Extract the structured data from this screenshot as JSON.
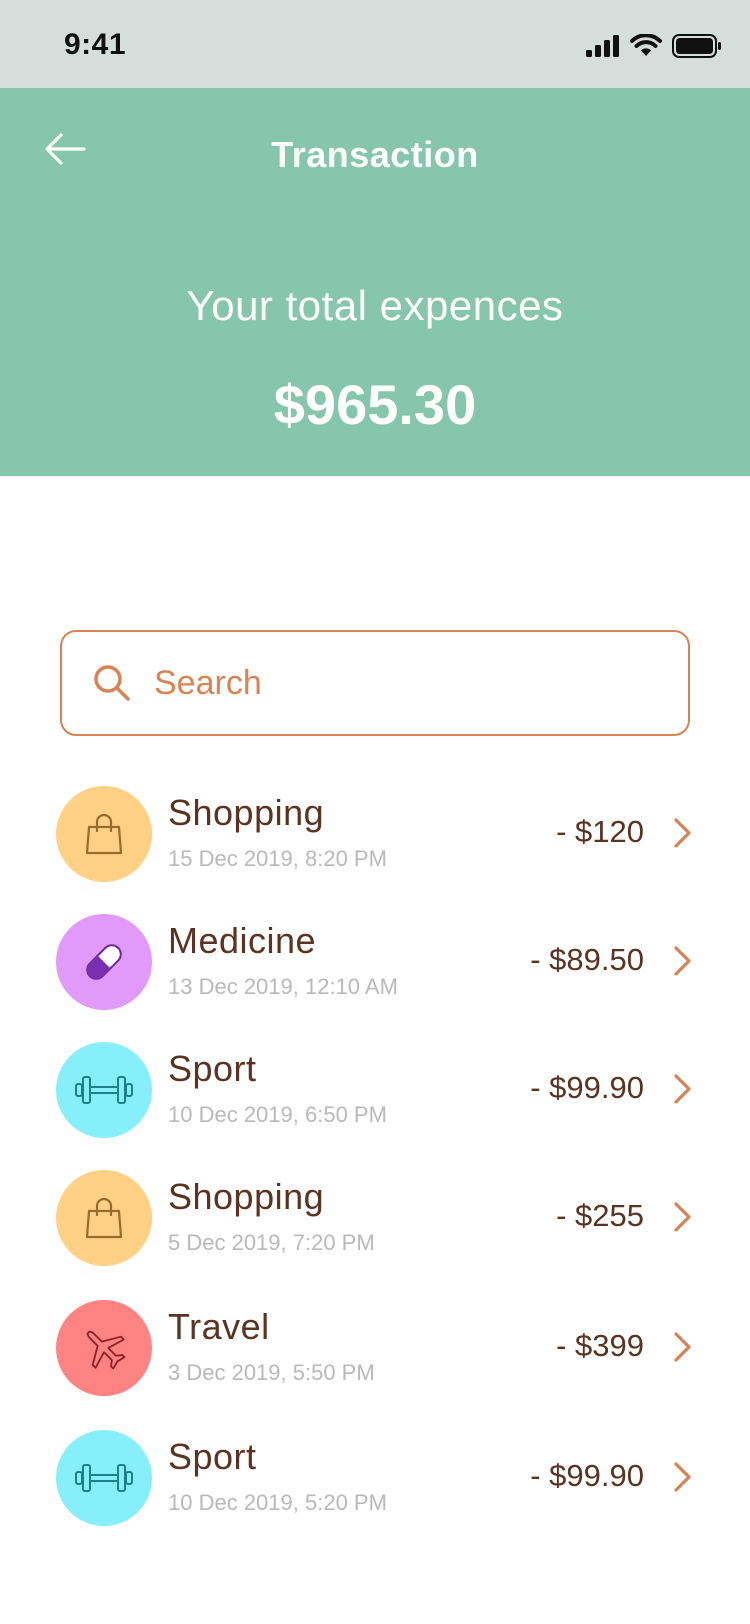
{
  "status_bar": {
    "time": "9:41"
  },
  "header": {
    "title": "Transaction",
    "total_label": "Your total expences",
    "total_amount": "$965.30"
  },
  "search": {
    "placeholder": "Search"
  },
  "colors": {
    "header_bg": "#86c5ae",
    "accent": "#d98352",
    "text_dark": "#5a3322",
    "shopping": "#ffd185",
    "medicine": "#e19afa",
    "sport": "#87effa",
    "travel": "#ff8383"
  },
  "transactions": [
    {
      "category": "Shopping",
      "date": "15 Dec 2019, 8:20 PM",
      "amount": "- $120",
      "icon": "shopping-bag-icon"
    },
    {
      "category": "Medicine",
      "date": "13 Dec 2019, 12:10 AM",
      "amount": "- $89.50",
      "icon": "pill-icon"
    },
    {
      "category": "Sport",
      "date": "10 Dec 2019, 6:50 PM",
      "amount": "- $99.90",
      "icon": "dumbbell-icon"
    },
    {
      "category": "Shopping",
      "date": "5 Dec 2019, 7:20 PM",
      "amount": "- $255",
      "icon": "shopping-bag-icon"
    },
    {
      "category": "Travel",
      "date": "3 Dec 2019, 5:50 PM",
      "amount": "- $399",
      "icon": "airplane-icon"
    },
    {
      "category": "Sport",
      "date": "10 Dec 2019, 5:20 PM",
      "amount": "- $99.90",
      "icon": "dumbbell-icon"
    }
  ]
}
